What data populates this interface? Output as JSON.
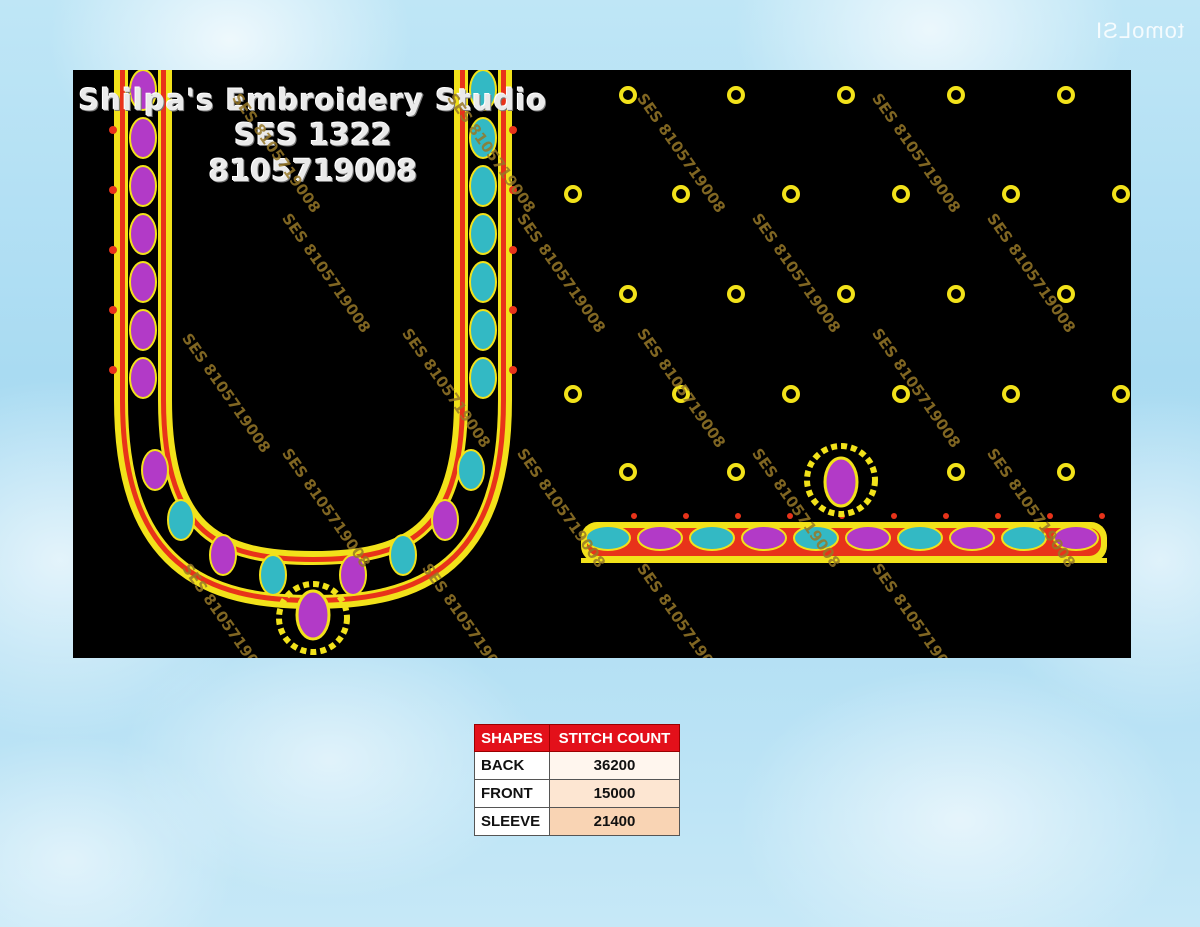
{
  "corner_mark": "tomoLSI",
  "design": {
    "studio_name": "Shilpa's Embroidery Studio",
    "design_code": "SES 1322",
    "phone": "8105719008",
    "watermark": "SES 8105719008",
    "thread_colors": {
      "outline": "#f2e21a",
      "paisley_pink": "#b23ac7",
      "paisley_cyan": "#33b9c4",
      "accent_red": "#e8331a",
      "background": "#000000"
    }
  },
  "table": {
    "headers": [
      "SHAPES",
      "STITCH COUNT"
    ],
    "rows": [
      {
        "shape": "BACK",
        "count": "36200"
      },
      {
        "shape": "FRONT",
        "count": "15000"
      },
      {
        "shape": "SLEEVE",
        "count": "21400"
      }
    ]
  }
}
